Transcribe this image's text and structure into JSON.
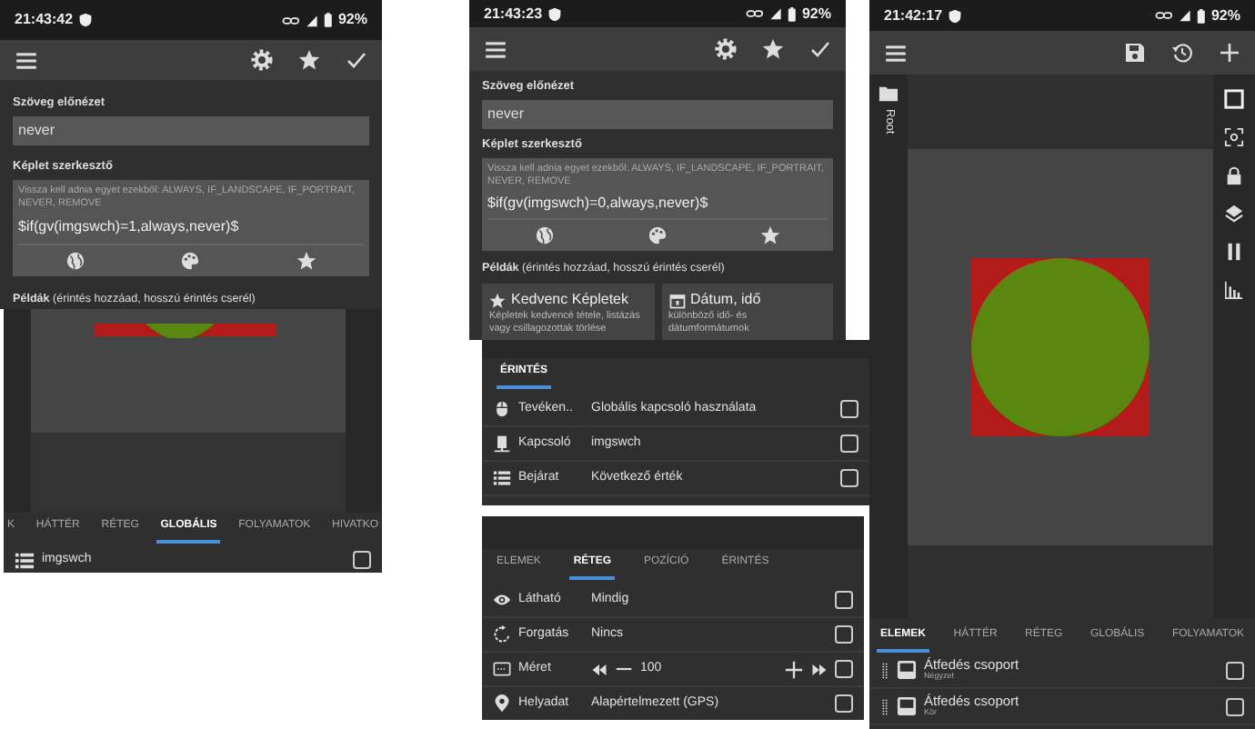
{
  "left_editor": {
    "status_bar": {
      "time": "21:43:42",
      "battery": "92%"
    },
    "preview_label": "Szöveg előnézet",
    "preview": "never",
    "formula_label": "Képlet szerkesztő",
    "formula_hint": "Vissza kell adnia egyet ezekből: ALWAYS, IF_LANDSCAPE, IF_PORTRAIT, NEVER, REMOVE",
    "formula": "$if(gv(imgswch)=1,always,never)$",
    "examples_label": "**Példák** (érintés hozzáad, hosszú érintés cserél)"
  },
  "left_layout": {
    "tabs": [
      {
        "label": "K",
        "selected": false
      },
      {
        "label": "HÁTTÉR",
        "selected": false
      },
      {
        "label": "RÉTEG",
        "selected": false
      },
      {
        "label": "GLOBÁLIS",
        "selected": true
      },
      {
        "label": "FOLYAMATOK",
        "selected": false
      },
      {
        "label": "HIVATKO",
        "selected": false
      }
    ],
    "rows": [
      {
        "label": "imgswch",
        "checked": false
      }
    ]
  },
  "middle_editor": {
    "status_bar": {
      "time": "21:43:23",
      "battery": "92%"
    },
    "preview_label": "Szöveg előnézet",
    "preview": "never",
    "formula_label": "Képlet szerkesztő",
    "formula_hint": "Vissza kell adnia egyet ezekből: ALWAYS, IF_LANDSCAPE, IF_PORTRAIT, NEVER, REMOVE",
    "formula": "$if(gv(imgswch)=0,always,never)$",
    "examples_label": "**Példák** (érintés hozzáad, hosszú érintés cserél)",
    "cards": [
      {
        "kind": "favorites",
        "title": "Kedvenc Képletek",
        "description": "Képletek kedvencé tétele, listázás vagy csillagozottak törlése"
      },
      {
        "kind": "datetime",
        "title": "Dátum, idő",
        "description": "különböző idő- és dátumformátumok"
      }
    ]
  },
  "touch_panel": {
    "tabs": [
      {
        "label": "ÉRINTÉS",
        "selected": true
      }
    ],
    "rows": [
      {
        "kind": "action",
        "label": "Tevéken..",
        "value": "Globális kapcsoló használata",
        "checked": false
      },
      {
        "kind": "switch",
        "label": "Kapcsoló",
        "value": "imgswch",
        "checked": false
      },
      {
        "kind": "entry",
        "label": "Bejárat",
        "value": "Következő érték",
        "checked": false
      }
    ]
  },
  "layer_panel": {
    "tabs": [
      {
        "label": "ELEMEK",
        "selected": false
      },
      {
        "label": "RÉTEG",
        "selected": true
      },
      {
        "label": "POZÍCIÓ",
        "selected": false
      },
      {
        "label": "ÉRINTÉS",
        "selected": false
      }
    ],
    "rows": [
      {
        "kind": "visibility",
        "label": "Látható",
        "value": "Mindig",
        "checked": false
      },
      {
        "kind": "rotation",
        "label": "Forgatás",
        "value": "Nincs",
        "checked": false
      },
      {
        "kind": "size",
        "label": "Méret",
        "value": "100",
        "checked": false
      },
      {
        "kind": "location",
        "label": "Helyadat",
        "value": "Alapértelmezett (GPS)",
        "checked": false
      }
    ]
  },
  "main_screen": {
    "status_bar": {
      "time": "21:42:17",
      "battery": "92%"
    },
    "folder_label": "Root",
    "tabs": [
      {
        "label": "ELEMEK",
        "selected": true
      },
      {
        "label": "HÁTTÉR",
        "selected": false
      },
      {
        "label": "RÉTEG",
        "selected": false
      },
      {
        "label": "GLOBÁLIS",
        "selected": false
      },
      {
        "label": "FOLYAMATOK",
        "selected": false
      }
    ],
    "items": [
      {
        "title": "Átfedés csoport",
        "subtitle": "Négyzet",
        "checked": false
      },
      {
        "title": "Átfedés csoport",
        "subtitle": "Kör",
        "checked": false
      }
    ]
  }
}
